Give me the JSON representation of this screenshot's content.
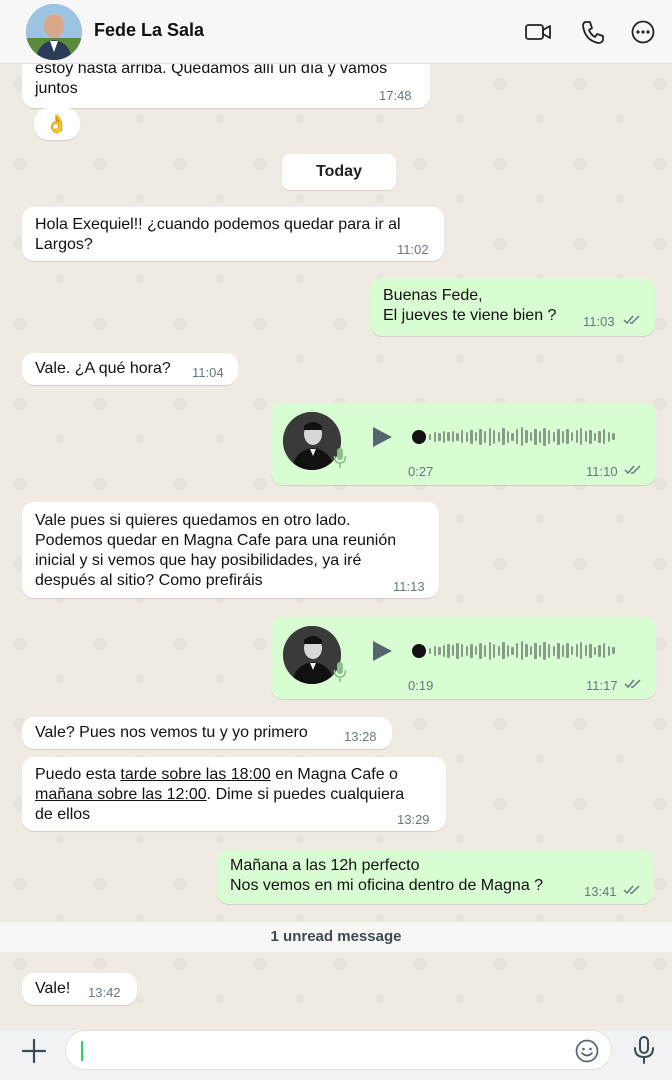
{
  "header": {
    "contact_name": "Fede La Sala",
    "icons": [
      "video-call-icon",
      "voice-call-icon",
      "more-options-icon"
    ]
  },
  "messages": [
    {
      "dir": "in",
      "lines": [
        "estoy hasta arriba. Quedamos allí un día y vamos",
        "juntos"
      ],
      "time": "17:48"
    },
    {
      "dir": "in",
      "emoji": "👌"
    },
    {
      "type": "date",
      "label": "Today"
    },
    {
      "dir": "in",
      "lines": [
        "Hola Exequiel!! ¿cuando podemos quedar para ir al",
        "Largos?"
      ],
      "time": "11:02"
    },
    {
      "dir": "out",
      "lines": [
        "Buenas Fede,",
        "El jueves te viene bien ?"
      ],
      "time": "11:03",
      "status": "read"
    },
    {
      "dir": "in",
      "lines": [
        "Vale. ¿A qué hora?"
      ],
      "time": "11:04"
    },
    {
      "dir": "out",
      "type": "voice",
      "duration": "0:27",
      "time": "11:10",
      "status": "read"
    },
    {
      "dir": "in",
      "lines": [
        "Vale pues si quieres quedamos en otro lado.",
        "Podemos quedar en Magna Cafe para una reunión",
        "inicial y si vemos que hay posibilidades, ya iré",
        "después al sitio? Como prefiráis"
      ],
      "time": "11:13"
    },
    {
      "dir": "out",
      "type": "voice",
      "duration": "0:19",
      "time": "11:17",
      "status": "read"
    },
    {
      "dir": "in",
      "lines": [
        "Vale? Pues nos vemos tu y yo primero"
      ],
      "time": "13:28"
    },
    {
      "dir": "in",
      "parts": {
        "l1a": "Puedo esta ",
        "l1b": "tarde sobre las 18:00",
        "l1c": " en Magna Cafe o",
        "l2a": "mañana sobre las 12:00",
        "l2b": ". Dime si puedes cualquiera",
        "l3": "de ellos"
      },
      "time": "13:29"
    },
    {
      "dir": "out",
      "lines": [
        "Mañana a las 12h perfecto",
        "Nos vemos en mi oficina dentro de Magna ?"
      ],
      "time": "13:41",
      "status": "read"
    },
    {
      "type": "unread",
      "label": "1 unread message"
    },
    {
      "dir": "in",
      "lines": [
        "Vale!"
      ],
      "time": "13:42"
    }
  ],
  "composer": {
    "input_value": "",
    "icons": [
      "plus-icon",
      "emoji-icon",
      "microphone-icon"
    ]
  },
  "colors": {
    "incoming": "#ffffff",
    "outgoing": "#d9fdd3",
    "background": "#efeae2",
    "read_ticks": "#667781"
  }
}
